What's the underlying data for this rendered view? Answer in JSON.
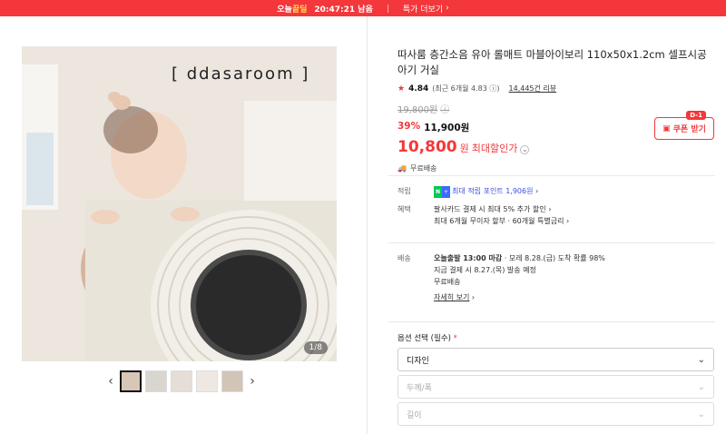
{
  "topbar": {
    "deal_prefix": "오늘",
    "deal_accent": "끝딜",
    "timer": "20:47:21 남음",
    "more_label": "특가 더보기",
    "more_icon": "chevron-right-icon"
  },
  "gallery": {
    "brand_text": "ddasaroom",
    "counter": "1/8",
    "prev_icon": "chevron-left-icon",
    "next_icon": "chevron-right-icon",
    "thumbnails": [
      "thumb-1",
      "thumb-2",
      "thumb-3",
      "thumb-4",
      "thumb-5"
    ]
  },
  "product": {
    "title": "따사룸 층간소음 유아 롤매트 마블아이보리 110x50x1.2cm 셀프시공 아기 거실",
    "rating": "4.84",
    "rating_detail": "(최근 6개월 4.83",
    "reviews": "14,445건 리뷰",
    "original_price": "19,800원",
    "discount_pct": "39%",
    "sale_price": "11,900원",
    "max_discount_price": "10,800",
    "won": "원",
    "max_discount_label": "최대할인가",
    "coupon_label": "쿠폰 받기",
    "coupon_badge": "D-1",
    "free_shipping": "무료배송"
  },
  "details": {
    "points_label": "적립",
    "points_value": "최대 적립 포인트 1,906원",
    "benefit_label": "혜택",
    "benefit_line1": "팔사카드 결제 시 최대 5% 추가 할인",
    "benefit_line2": "최대 6개월 무이자 할부 · 60개월 특별금리",
    "shipping_label": "배송",
    "ship_line1_bold": "오늘출발 13:00 마감",
    "ship_line1_rest": "모레 8.28.(금) 도착 확률 98%",
    "ship_line2": "지금 결제 시 8.27.(목) 발송 예정",
    "ship_line3": "무료배송",
    "ship_more": "자세히 보기"
  },
  "options": {
    "label": "옵션 선택 (필수)",
    "required_mark": "*",
    "select1": "디자인",
    "select2": "두께/폭",
    "select3": "길이"
  },
  "colors": {
    "accent": "#f4373a",
    "naver_green": "#03c75a",
    "link_blue": "#3d4fe0"
  }
}
